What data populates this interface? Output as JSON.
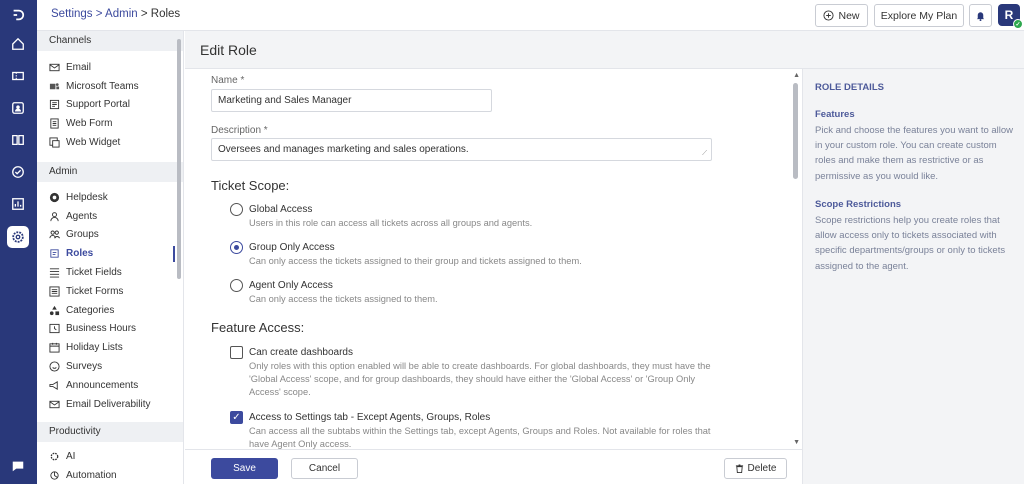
{
  "rail": {
    "icons": [
      "logo-icon",
      "home-icon",
      "ticket-icon",
      "contact-icon",
      "book-icon",
      "check-circle-icon",
      "report-icon",
      "settings-icon"
    ],
    "chat_icon": "chat-icon"
  },
  "topbar": {
    "breadcrumb": {
      "settings": "Settings",
      "sep1": " > ",
      "admin": "Admin",
      "sep2": " > ",
      "current": "Roles"
    },
    "new_label": "New",
    "explore_label": "Explore My Plan",
    "avatar_initial": "R"
  },
  "sidebar": {
    "sections": [
      {
        "title": "Channels",
        "items": [
          {
            "label": "Email",
            "icon": "mail-icon"
          },
          {
            "label": "Microsoft Teams",
            "icon": "teams-icon"
          },
          {
            "label": "Support Portal",
            "icon": "portal-icon"
          },
          {
            "label": "Web Form",
            "icon": "form-icon"
          },
          {
            "label": "Web Widget",
            "icon": "widget-icon"
          }
        ]
      },
      {
        "title": "Admin",
        "items": [
          {
            "label": "Helpdesk",
            "icon": "helpdesk-icon"
          },
          {
            "label": "Agents",
            "icon": "agents-icon"
          },
          {
            "label": "Groups",
            "icon": "groups-icon"
          },
          {
            "label": "Roles",
            "icon": "roles-icon",
            "active": true
          },
          {
            "label": "Ticket Fields",
            "icon": "fields-icon"
          },
          {
            "label": "Ticket Forms",
            "icon": "ticket-forms-icon"
          },
          {
            "label": "Categories",
            "icon": "categories-icon"
          },
          {
            "label": "Business Hours",
            "icon": "clock-icon"
          },
          {
            "label": "Holiday Lists",
            "icon": "calendar-icon"
          },
          {
            "label": "Surveys",
            "icon": "survey-icon"
          },
          {
            "label": "Announcements",
            "icon": "megaphone-icon"
          },
          {
            "label": "Email Deliverability",
            "icon": "deliverability-icon"
          }
        ]
      },
      {
        "title": "Productivity",
        "items": [
          {
            "label": "AI",
            "icon": "ai-icon"
          },
          {
            "label": "Automation",
            "icon": "automation-icon"
          }
        ]
      }
    ]
  },
  "page": {
    "title": "Edit Role",
    "name_label": "Name *",
    "name_value": "Marketing and Sales Manager",
    "desc_label": "Description *",
    "desc_value": "Oversees and manages marketing and sales operations.",
    "scope_heading": "Ticket Scope:",
    "scope_options": [
      {
        "title": "Global Access",
        "desc": "Users in this role can access all tickets across all groups and agents.",
        "selected": false
      },
      {
        "title": "Group Only Access",
        "desc": "Can only access the tickets assigned to their group and tickets assigned to them.",
        "selected": true
      },
      {
        "title": "Agent Only Access",
        "desc": "Can only access the tickets assigned to them.",
        "selected": false
      }
    ],
    "feature_heading": "Feature Access:",
    "features": [
      {
        "title": "Can create dashboards",
        "desc": "Only roles with this option enabled will be able to create dashboards. For global dashboards, they must have the 'Global Access' scope, and for group dashboards, they should have either the 'Global Access' or 'Group Only Access' scope.",
        "checked": false
      },
      {
        "title": "Access to Settings tab - Except Agents, Groups, Roles",
        "desc": "Can access all the subtabs within the Settings tab, except Agents, Groups and Roles. Not available for roles that have Agent Only access.",
        "checked": true
      }
    ]
  },
  "footer": {
    "save": "Save",
    "cancel": "Cancel",
    "delete": "Delete"
  },
  "details": {
    "heading": "ROLE DETAILS",
    "features_title": "Features",
    "features_text": "Pick and choose the features you want to allow in your custom role. You can create custom roles and make them as restrictive or as permissive as you would like.",
    "scope_title": "Scope Restrictions",
    "scope_text": "Scope restrictions help you create roles that allow access only to tickets associated with specific departments/groups or only to tickets assigned to the agent."
  },
  "colors": {
    "brand": "#29387a",
    "accent": "#3c4a9e",
    "panel": "#f3f4f6"
  }
}
